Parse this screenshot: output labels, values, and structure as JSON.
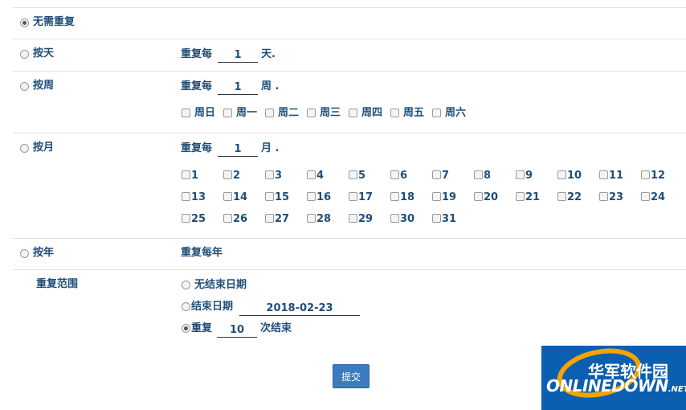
{
  "options": {
    "none": "无需重复",
    "daily": "按天",
    "weekly": "按周",
    "monthly": "按月",
    "yearly": "按年"
  },
  "daily": {
    "prefix": "重复每",
    "value": "1",
    "suffix": "天."
  },
  "weekly": {
    "prefix": "重复每",
    "value": "1",
    "suffix": "周 .",
    "days": [
      "周日",
      "周一",
      "周二",
      "周三",
      "周四",
      "周五",
      "周六"
    ]
  },
  "monthly": {
    "prefix": "重复每",
    "value": "1",
    "suffix": "月 .",
    "days": [
      "1",
      "2",
      "3",
      "4",
      "5",
      "6",
      "7",
      "8",
      "9",
      "10",
      "11",
      "12",
      "13",
      "14",
      "15",
      "16",
      "17",
      "18",
      "19",
      "20",
      "21",
      "22",
      "23",
      "24",
      "25",
      "26",
      "27",
      "28",
      "29",
      "30",
      "31"
    ]
  },
  "yearly": {
    "label": "重复每年"
  },
  "range": {
    "label": "重复范围",
    "no_end": "无结束日期",
    "end_date_label": "结束日期",
    "end_date_value": "2018-02-23",
    "repeat_prefix": "重复",
    "repeat_value": "10",
    "repeat_suffix": "次结束"
  },
  "submit_label": "提交",
  "watermark": {
    "cn": "华军软件园",
    "en": "ONLINEDOWN",
    "net": ".NET"
  },
  "colors": {
    "text": "#1f4e79",
    "button": "#3b7bbf",
    "logo_bg": "#0b5fb0"
  }
}
